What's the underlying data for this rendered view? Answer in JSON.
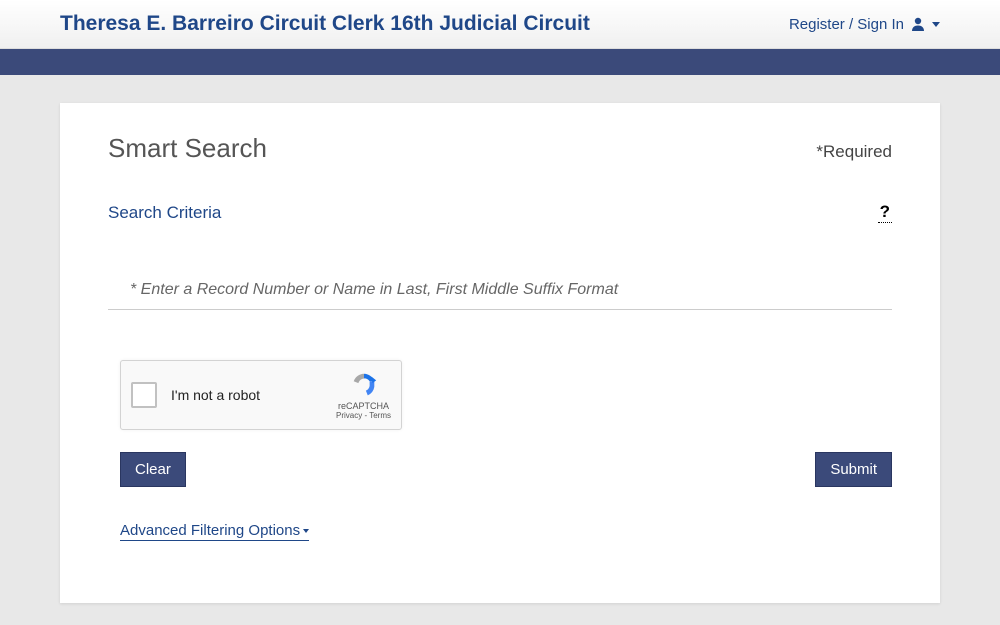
{
  "header": {
    "title": "Theresa E. Barreiro Circuit Clerk 16th Judicial Circuit",
    "signin_label": "Register / Sign In"
  },
  "card": {
    "title": "Smart Search",
    "required_label": "*Required",
    "criteria_label": "Search Criteria",
    "help_symbol": "?",
    "search_placeholder": "* Enter a Record Number or Name in Last, First Middle Suffix Format",
    "recaptcha_label": "I'm not a robot",
    "recaptcha_brand": "reCAPTCHA",
    "recaptcha_links": "Privacy - Terms",
    "clear_label": "Clear",
    "submit_label": "Submit",
    "advanced_label": "Advanced Filtering Options"
  }
}
